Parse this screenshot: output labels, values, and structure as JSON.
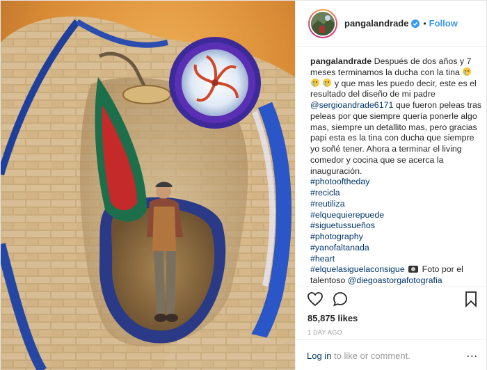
{
  "photo": {
    "alt_subject": "shower-and-tub-photo"
  },
  "header": {
    "username": "pangalandrade",
    "separator": "•",
    "follow_label": "Follow"
  },
  "caption": {
    "username": "pangalandrade",
    "text_1": "Después de dos años y 7 meses terminamos la ducha con la tina",
    "text_2": "y que mas les puedo decir, este es el resultado del diseño de mi padre",
    "mention": "@sergioandrade6171",
    "text_3": "que fueron peleas tras peleas por que siempre quería ponerle algo mas, siempre un detallito mas, pero gracias papi esta es la tina con ducha que siempre yo soñé tener. Ahora a terminar el living comedor y cocina que se acerca la inauguración.",
    "hashtags": [
      "#photooftheday",
      "#recicla",
      "#reutiliza",
      "#elquequierepuede",
      "#siguetussueños",
      "#photography",
      "#yanofaltanada",
      "#heart"
    ],
    "last_tag": "#elquelasiguelaconsigue",
    "last_text": "Foto por el talentoso",
    "last_mention": "@diegoastorgafotografia"
  },
  "actions": {
    "likes": "85,875 likes",
    "time": "1 DAY AGO",
    "login_link": "Log in",
    "login_text": " to like or comment.",
    "more": "..."
  },
  "colors": {
    "link_blue": "#3897f0",
    "dark_link": "#003569",
    "muted": "#999999",
    "text": "#262626"
  },
  "icons": [
    "verified-badge-icon",
    "heart-icon",
    "comment-icon",
    "bookmark-icon",
    "more-options-icon",
    "crying-emoji-icon",
    "camera-emoji-icon"
  ]
}
